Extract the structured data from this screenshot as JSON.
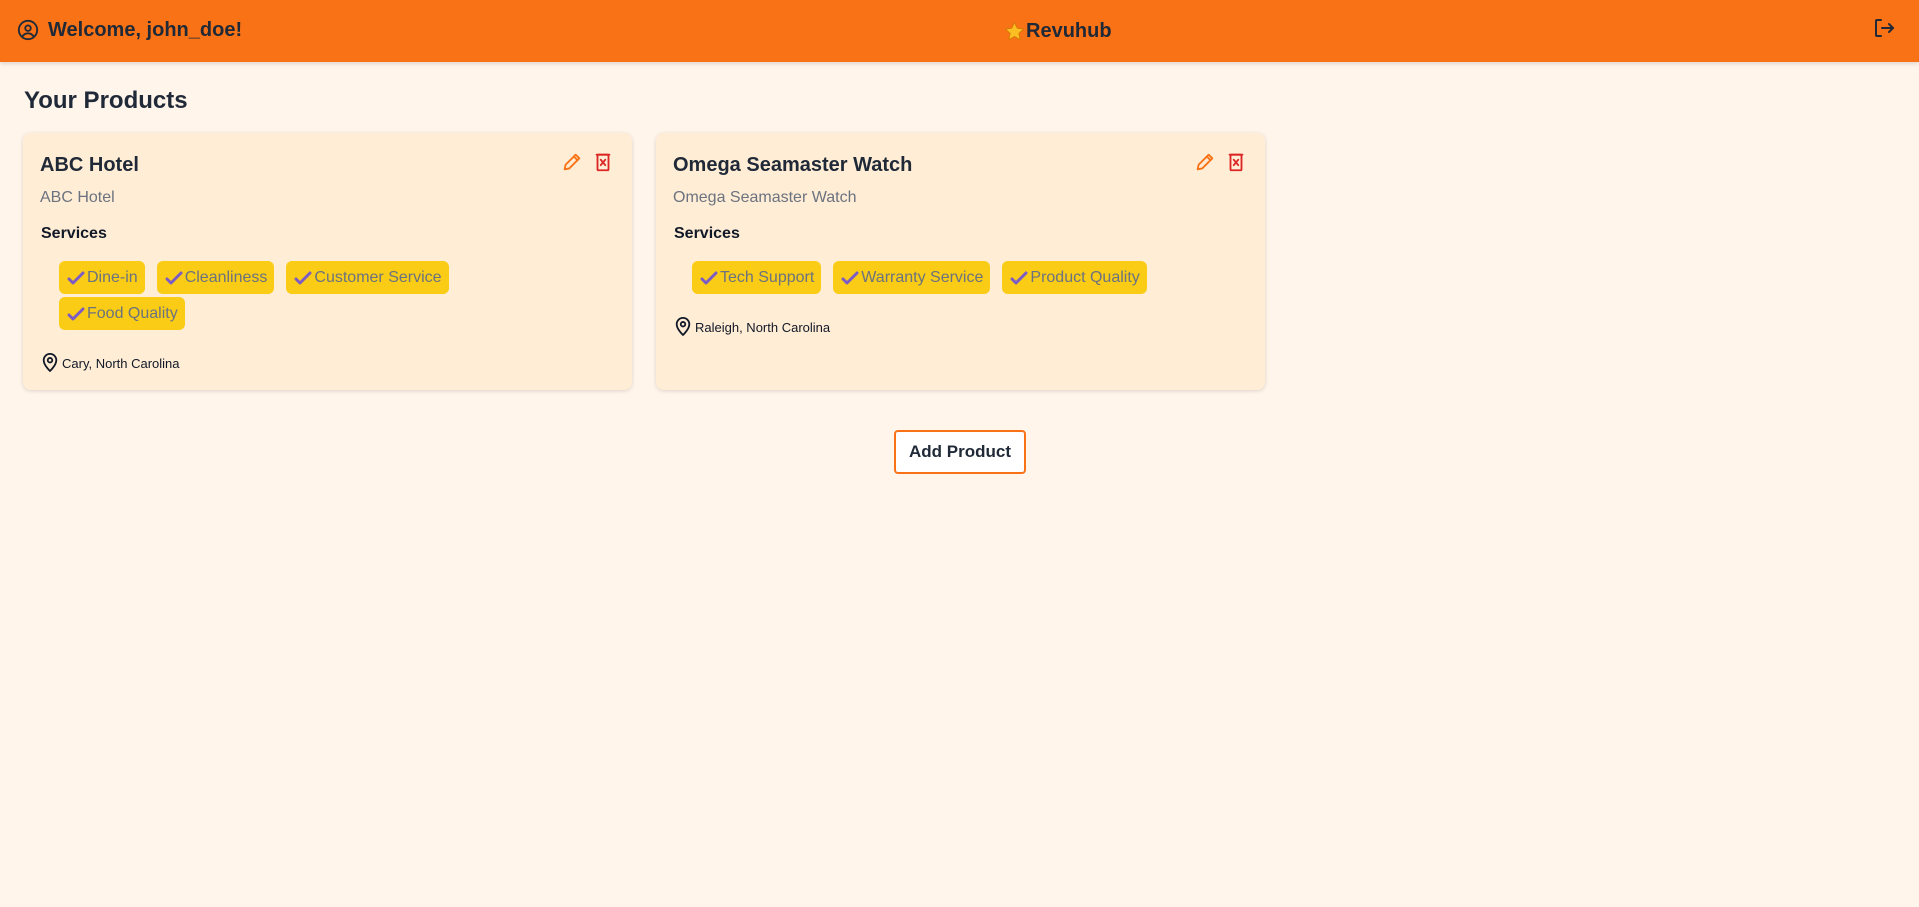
{
  "header": {
    "welcome_text": "Welcome, john_doe!",
    "brand_name": "Revuhub",
    "user_icon": "user-circle-icon",
    "brand_icon": "star-icon",
    "logout_icon": "logout-icon"
  },
  "main": {
    "title": "Your Products",
    "services_label": "Services",
    "add_button_label": "Add Product"
  },
  "products": [
    {
      "name": "ABC Hotel",
      "description": "ABC Hotel",
      "services": [
        "Dine-in",
        "Cleanliness",
        "Customer Service",
        "Food Quality"
      ],
      "location": "Cary, North Carolina"
    },
    {
      "name": "Omega Seamaster Watch",
      "description": "Omega Seamaster Watch",
      "services": [
        "Tech Support",
        "Warranty Service",
        "Product Quality"
      ],
      "location": "Raleigh, North Carolina"
    }
  ],
  "colors": {
    "header_bg": "#f97316",
    "page_bg": "#fff5eb",
    "card_bg": "#ffedd5",
    "chip_bg": "#facc15",
    "check_color": "#7c5cc4",
    "edit_color": "#f97316",
    "delete_color": "#dc2626"
  }
}
